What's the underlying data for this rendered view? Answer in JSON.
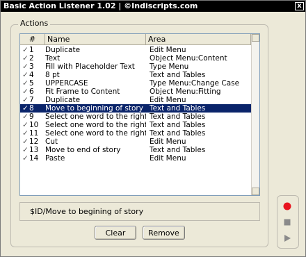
{
  "window": {
    "title": "Basic Action Listener 1.02  |  ©Indiscripts.com",
    "close_glyph": "x"
  },
  "group": {
    "label": "Actions"
  },
  "list": {
    "columns": [
      "#",
      "Name",
      "Area"
    ],
    "rows": [
      {
        "checked": true,
        "num": "1",
        "name": "Duplicate",
        "area": "Edit Menu",
        "selected": false
      },
      {
        "checked": true,
        "num": "2",
        "name": "Text",
        "area": "Object Menu:Content",
        "selected": false
      },
      {
        "checked": true,
        "num": "3",
        "name": "Fill with Placeholder Text",
        "area": "Type Menu",
        "selected": false
      },
      {
        "checked": true,
        "num": "4",
        "name": "8 pt",
        "area": "Text and Tables",
        "selected": false
      },
      {
        "checked": true,
        "num": "5",
        "name": "UPPERCASE",
        "area": "Type Menu:Change Case",
        "selected": false
      },
      {
        "checked": true,
        "num": "6",
        "name": "Fit Frame to Content",
        "area": "Object Menu:Fitting",
        "selected": false
      },
      {
        "checked": true,
        "num": "7",
        "name": "Duplicate",
        "area": "Edit Menu",
        "selected": false
      },
      {
        "checked": true,
        "num": "8",
        "name": "Move to beginning of story",
        "area": "Text and Tables",
        "selected": true
      },
      {
        "checked": true,
        "num": "9",
        "name": "Select one word to the right",
        "area": "Text and Tables",
        "selected": false
      },
      {
        "checked": true,
        "num": "10",
        "name": "Select one word to the right",
        "area": "Text and Tables",
        "selected": false
      },
      {
        "checked": true,
        "num": "11",
        "name": "Select one word to the right",
        "area": "Text and Tables",
        "selected": false
      },
      {
        "checked": true,
        "num": "12",
        "name": "Cut",
        "area": "Edit Menu",
        "selected": false
      },
      {
        "checked": true,
        "num": "13",
        "name": "Move to end of story",
        "area": "Text and Tables",
        "selected": false
      },
      {
        "checked": true,
        "num": "14",
        "name": "Paste",
        "area": "Edit Menu",
        "selected": false
      }
    ]
  },
  "status": {
    "text": "$ID/Move to begining of story"
  },
  "buttons": {
    "clear": "Clear",
    "remove": "Remove"
  },
  "recorder": {
    "record_icon": "record-icon",
    "stop_icon": "stop-icon",
    "play_icon": "play-icon",
    "record_color": "#e8141e",
    "control_color": "#8a8a8a"
  },
  "colors": {
    "selection": "#0a246a",
    "titlebar": "#000000",
    "window_bg": "#ece9d8"
  }
}
